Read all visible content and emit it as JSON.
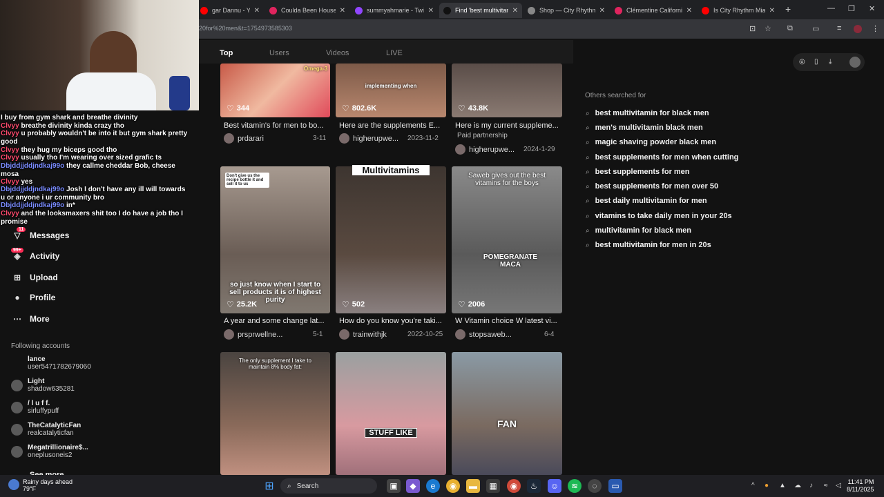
{
  "browser": {
    "tabs": [
      {
        "title": "gar Dannu - YouTub",
        "icon_color": "#ff0000",
        "active": false
      },
      {
        "title": "Coulda Been House 2",
        "icon_color": "#e0245e",
        "active": false
      },
      {
        "title": "summyahmarie - Twit",
        "icon_color": "#9146ff",
        "active": false
      },
      {
        "title": "Find 'best multivitamin",
        "icon_color": "#111111",
        "active": true
      },
      {
        "title": "Shop — City Rhythm",
        "icon_color": "#888888",
        "active": false
      },
      {
        "title": "Clémentine California",
        "icon_color": "#e0245e",
        "active": false
      },
      {
        "title": "Is City Rhythm Miami",
        "icon_color": "#ff0000",
        "active": false
      }
    ],
    "url": "20for%20men&t=1754973585303",
    "new_tab": "+",
    "window_controls": [
      "—",
      "❐",
      "✕"
    ]
  },
  "search_tabs": [
    "Top",
    "Users",
    "Videos",
    "LIVE"
  ],
  "cards": [
    {
      "likes": "344",
      "title": "Best vitamin's for men to bo...",
      "author": "prdarari",
      "date": "3-11",
      "paid": "",
      "overlay": "",
      "thumb": "#d86f5a"
    },
    {
      "likes": "802.6K",
      "title": "Here are the supplements E...",
      "author": "higherupwe...",
      "date": "2023-11-2",
      "paid": "",
      "overlay": "implementing when",
      "thumb": "#8a6552"
    },
    {
      "likes": "43.8K",
      "title": "Here is my current suppleme...",
      "author": "higherupwe...",
      "date": "2024-1-29",
      "paid": "Paid partnership",
      "overlay": "",
      "thumb": "#6a5b55"
    },
    {
      "likes": "25.2K",
      "title": "A year and some change lat...",
      "author": "prsprwellne...",
      "date": "5-1",
      "paid": "",
      "overlay": "so just know when I start to sell products it is of highest purity",
      "thumb": "#8a7a70"
    },
    {
      "likes": "502",
      "title": "How do you know you're taki...",
      "author": "trainwithjk",
      "date": "2022-10-25",
      "paid": "",
      "overlay": "Multivitamins",
      "thumb": "#55483f"
    },
    {
      "likes": "2006",
      "title": "W Vitamin choice W latest vi...",
      "author": "stopsaweb...",
      "date": "6-4",
      "paid": "",
      "overlay": "Saweb gives out the best vitamins for the boys",
      "thumb": "#6e6e6e"
    },
    {
      "likes": "",
      "title": "",
      "author": "",
      "date": "",
      "paid": "",
      "overlay": "The only supplement I take to maintain 8% body fat:",
      "thumb": "#7a6a62"
    },
    {
      "likes": "",
      "title": "",
      "author": "",
      "date": "",
      "paid": "",
      "overlay": "STUFF LIKE",
      "thumb": "#b88a8a"
    },
    {
      "likes": "",
      "title": "",
      "author": "",
      "date": "",
      "paid": "",
      "overlay": "FAN",
      "thumb": "#6a6a6a"
    }
  ],
  "card_overlays_extra": {
    "card1_bottle": "Omega-3",
    "card3_pill": "Don't give us the recipe bottle it and sell it to us",
    "card5_caption": "POMEGRANATE MACA"
  },
  "others": {
    "title": "Others searched for",
    "items": [
      "best multivitamin for black men",
      "men's multivitamin black men",
      "magic shaving powder black men",
      "best supplements for men when cutting",
      "best supplements for men",
      "best supplements for men over 50",
      "best daily multivitamin for men",
      "vitamins to take daily men in your 20s",
      "multivitamin for black men",
      "best multivitamin for men in 20s"
    ]
  },
  "sidebar": {
    "nav": [
      {
        "label": "Messages",
        "badge": "11"
      },
      {
        "label": "Activity",
        "badge": "99+"
      },
      {
        "label": "Upload",
        "badge": ""
      },
      {
        "label": "Profile",
        "badge": ""
      },
      {
        "label": "More",
        "badge": ""
      }
    ],
    "following_title": "Following accounts",
    "following": [
      {
        "name": "lance",
        "handle": "user5471782679060"
      },
      {
        "name": "Light",
        "handle": "shadow635281"
      },
      {
        "name": "/ l u f f.",
        "handle": "sirluffypuff"
      },
      {
        "name": "TheCatalyticFan",
        "handle": "realcatalyticfan"
      },
      {
        "name": "Megatrillionaire$...",
        "handle": "oneplusoneis2"
      }
    ],
    "see_more": "See more"
  },
  "chat": [
    {
      "user": "",
      "text": "I buy from gym shark and breathe divinity"
    },
    {
      "user": "Clvyy",
      "text": "breathe divinity kinda crazy tho"
    },
    {
      "user": "Clvyy",
      "text": "u probably wouldn't be into it but gym shark pretty good"
    },
    {
      "user": "Clvyy",
      "text": "they hug my biceps good tho"
    },
    {
      "user": "Clvyy",
      "text": "usually tho I'm wearing over sized grafic ts"
    },
    {
      "user": "Dbjddjjddjndkaj99o",
      "text": "they callme cheddar Bob, cheese mosa"
    },
    {
      "user": "Clvyy",
      "text": "yes"
    },
    {
      "user": "Dbjddjjddjndkaj99o",
      "text": "Josh I don't have any ill will towards u or anyone i ur community bro"
    },
    {
      "user": "Dbjddjjddjndkaj99o",
      "text": "in*"
    },
    {
      "user": "Clvyy",
      "text": "and the looksmaxers shit too I do have a job tho I promise"
    }
  ],
  "taskbar": {
    "weather_line1": "Rainy days ahead",
    "weather_line2": "79°F",
    "search_placeholder": "Search",
    "time": "11:41 PM",
    "date": "8/11/2025"
  }
}
